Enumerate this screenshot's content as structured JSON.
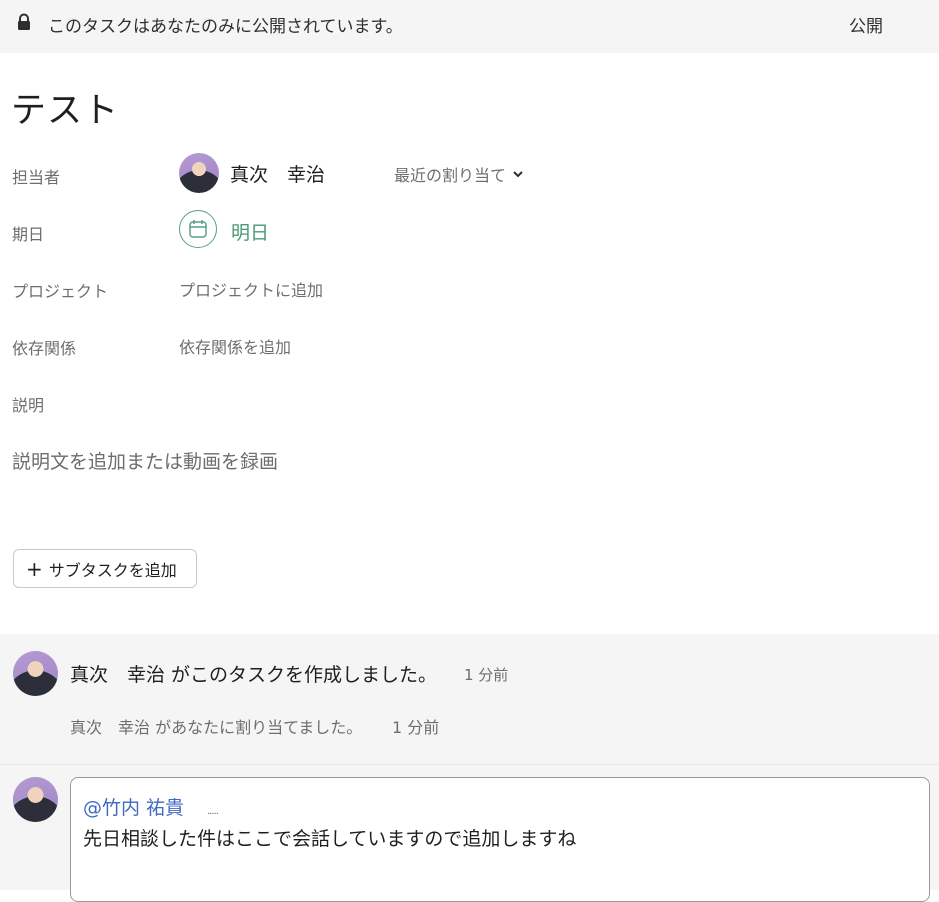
{
  "banner": {
    "icon": "lock-icon",
    "message": "このタスクはあなたのみに公開されています。",
    "visibility_button": "公開"
  },
  "task": {
    "title": "テスト"
  },
  "fields": {
    "assignee_label": "担当者",
    "assignee_name": "真次　幸治",
    "recent_assignments": "最近の割り当て",
    "due_label": "期日",
    "due_value": "明日",
    "project_label": "プロジェクト",
    "project_add": "プロジェクトに追加",
    "dependency_label": "依存関係",
    "dependency_add": "依存関係を追加",
    "description_label": "説明",
    "description_placeholder": "説明文を追加または動画を録画"
  },
  "subtask": {
    "add_label": "サブタスクを追加"
  },
  "activity": {
    "created": "真次　幸治 がこのタスクを作成しました。",
    "created_time": "1 分前",
    "assigned": "真次　幸治 があなたに割り当てました。",
    "assigned_time": "1 分前"
  },
  "comment": {
    "mention": "@竹内 祐貴",
    "dots": ".....",
    "text": "先日相談した件はここで会話していますので追加しますね"
  },
  "colors": {
    "due_green": "#4a9a73",
    "mention_blue": "#3f6ac4",
    "banner_bg": "#f6f5f5"
  }
}
